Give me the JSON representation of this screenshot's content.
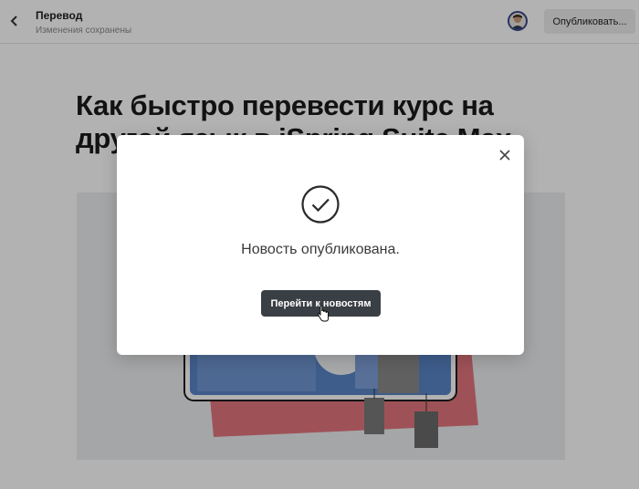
{
  "header": {
    "back_icon": "chevron-left-icon",
    "title": "Перевод",
    "subtitle": "Изменения сохранены",
    "publish_label": "Опубликовать..."
  },
  "article": {
    "title": "Как быстро перевести курс на другой язык в iSpring Suite Max"
  },
  "modal": {
    "close_icon": "close-icon",
    "status_icon": "check-circle-icon",
    "message": "Новость опубликована.",
    "button_label": "Перейти к новостям"
  },
  "colors": {
    "overlay": "#000000",
    "modal_button": "#3a3f45",
    "avatar_ring": "#3a4a8a",
    "hero_red": "#e0606a",
    "hero_blue": "#5a86c8"
  }
}
